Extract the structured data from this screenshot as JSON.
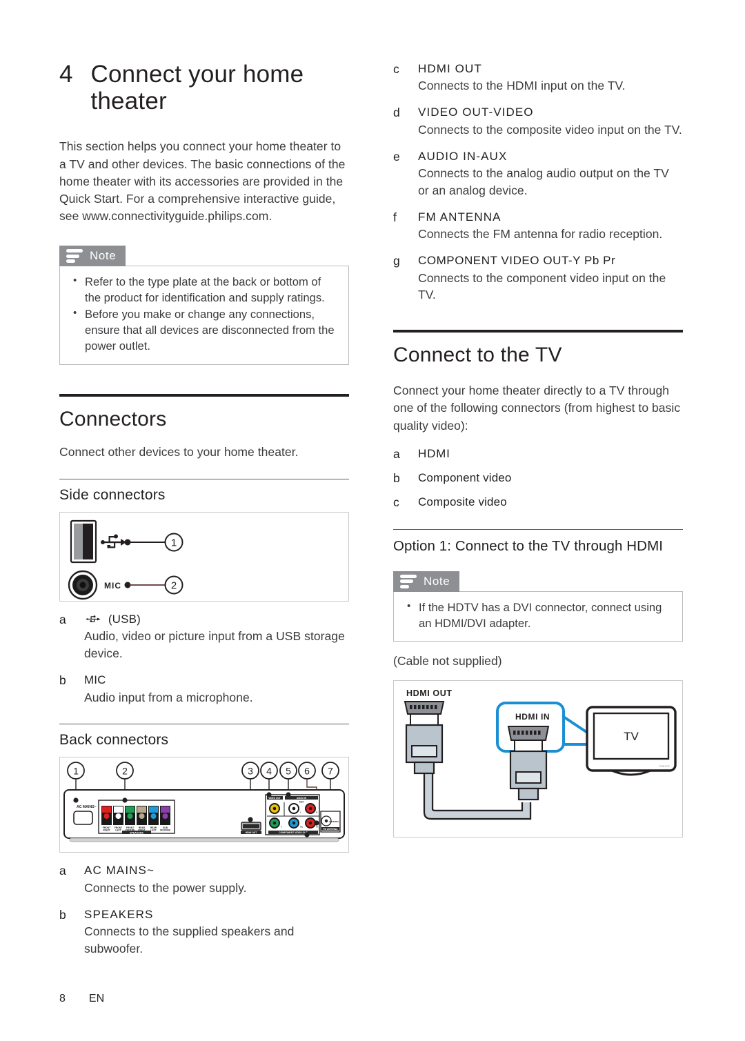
{
  "chapter": {
    "number": "4",
    "title": "Connect your home theater"
  },
  "intro": "This section helps you connect your home theater to a TV and other devices. The basic connections of the home theater with its accessories are provided in the Quick Start. For a comprehensive interactive guide, see www.connectivityguide.philips.com.",
  "note1": {
    "label": "Note",
    "items": [
      "Refer to the type plate at the back or bottom of the product for identification and supply ratings.",
      "Before you make or change any connections, ensure that all devices are disconnected from the power outlet."
    ]
  },
  "connectors": {
    "heading": "Connectors",
    "intro": "Connect other devices to your home theater.",
    "side_heading": "Side connectors",
    "back_heading": "Back connectors",
    "side_figure": {
      "usb_icon_name": "usb-icon",
      "mic_label": "MIC",
      "callouts": [
        "1",
        "2"
      ]
    },
    "back_figure": {
      "callouts": [
        "1",
        "2",
        "3",
        "4",
        "5",
        "6",
        "7"
      ],
      "ac_mains_label": "AC MAINS~",
      "speaker_block_label": "SPEAKERS",
      "speaker_ports": [
        {
          "name": "FRONT RIGHT",
          "color": "#e02020"
        },
        {
          "name": "FRONT LEFT",
          "color": "#ffffff"
        },
        {
          "name": "FRONT CENTRE",
          "color": "#1f9d55"
        },
        {
          "name": "REAR RIGHT",
          "color": "#b9a98c"
        },
        {
          "name": "REAR LEFT",
          "color": "#1f9ad6"
        },
        {
          "name": "SUBWOOFER",
          "color": "#8b3fa8"
        }
      ],
      "hdmi_out_label": "HDMI OUT",
      "video_out_label": "VIDEO OUT",
      "audio_in_label": "AUDIO IN",
      "aux_label": "AUX",
      "component_label": "COMPONENT VIDEO OUT",
      "antenna_label": "FM ANTENNA",
      "rca_ports": [
        {
          "name": "VIDEO",
          "color": "#f2c300"
        },
        {
          "name": "L",
          "color": "#ffffff"
        },
        {
          "name": "R",
          "color": "#e02020"
        },
        {
          "name": "Y",
          "color": "#1f9d55"
        },
        {
          "name": "Pb",
          "color": "#1f9ad6"
        },
        {
          "name": "Pr",
          "color": "#e02020"
        }
      ]
    },
    "side_items": [
      {
        "key": "a",
        "term": "(USB)",
        "term_icon": "usb-icon",
        "desc": "Audio, video or picture input from a USB storage device."
      },
      {
        "key": "b",
        "term": "MIC",
        "desc": "Audio input from a microphone."
      }
    ],
    "back_items_left": [
      {
        "key": "a",
        "term": "AC MAINS~",
        "desc": "Connects to the power supply."
      },
      {
        "key": "b",
        "term": "SPEAKERS",
        "desc": "Connects to the supplied speakers and subwoofer."
      }
    ],
    "back_items_right": [
      {
        "key": "c",
        "term": "HDMI OUT",
        "desc": "Connects to the HDMI input on the TV."
      },
      {
        "key": "d",
        "term": "VIDEO OUT-VIDEO",
        "desc": "Connects to the composite video input on the TV."
      },
      {
        "key": "e",
        "term": "AUDIO IN-AUX",
        "desc": "Connects to the analog audio output on the TV or an analog device."
      },
      {
        "key": "f",
        "term": "FM ANTENNA",
        "desc": "Connects the FM antenna for radio reception."
      },
      {
        "key": "g",
        "term": "COMPONENT VIDEO OUT-Y Pb Pr",
        "desc": "Connects to the component video input on the TV."
      }
    ]
  },
  "connect_tv": {
    "heading": "Connect to the TV",
    "intro": "Connect your home theater directly to a TV through one of the following connectors (from highest to basic quality video):",
    "options": [
      {
        "key": "a",
        "term": "HDMI"
      },
      {
        "key": "b",
        "term": "Component video"
      },
      {
        "key": "c",
        "term": "Composite video"
      }
    ],
    "option1_heading": "Option 1: Connect to the TV through HDMI",
    "note": {
      "label": "Note",
      "items": [
        "If the HDTV has a DVI connector, connect using an HDMI/DVI adapter."
      ]
    },
    "cable_caption": "(Cable not supplied)",
    "figure": {
      "hdmi_out_label": "HDMI OUT",
      "hdmi_in_label": "HDMI IN",
      "tv_label": "TV",
      "highlight_color": "#1b8fd4"
    }
  },
  "footer": {
    "page_number": "8",
    "language": "EN"
  }
}
